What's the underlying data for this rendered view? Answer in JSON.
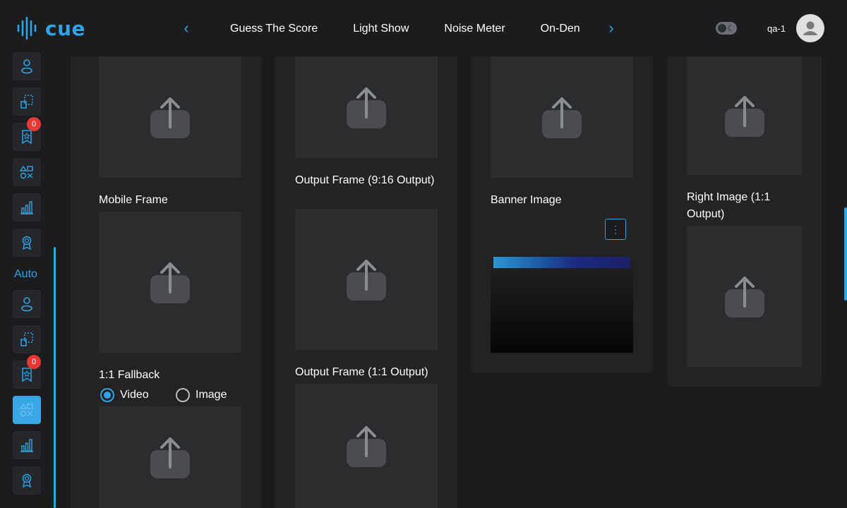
{
  "app": {
    "logo_text": "cue"
  },
  "nav": {
    "tabs": [
      "Guess The Score",
      "Light Show",
      "Noise Meter",
      "On-Den"
    ],
    "prev_icon": "chevron-left-icon",
    "next_icon": "chevron-right-icon"
  },
  "user": {
    "name": "qa-1"
  },
  "sidebar": {
    "section_label": "Auto",
    "badge_count": "0",
    "badge_count_2": "0"
  },
  "fields": {
    "mobile_frame": "Mobile Frame",
    "fallback": "1:1 Fallback",
    "radio_video": "Video",
    "radio_image": "Image",
    "output_frame_916": "Output Frame (9:16 Output)",
    "output_frame_11": "Output Frame (1:1 Output)",
    "banner_image": "Banner Image",
    "right_image": "Right Image (1:1 Output)"
  },
  "colors": {
    "accent": "#2ea3e6",
    "badge": "#e53935",
    "background": "#1c1c1e"
  }
}
